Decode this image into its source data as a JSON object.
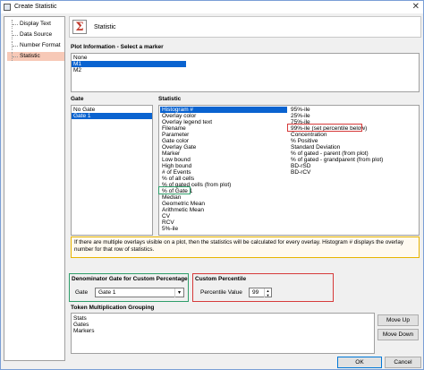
{
  "window": {
    "title": "Create Statistic",
    "close_glyph": "✕"
  },
  "nav": {
    "items": [
      {
        "label": "Display Text"
      },
      {
        "label": "Data Source"
      },
      {
        "label": "Number Format"
      },
      {
        "label": "Statistic",
        "selected": true
      }
    ]
  },
  "header": {
    "icon": "Σ",
    "title": "Statistic"
  },
  "plot_info": {
    "label": "Plot Information - Select a marker",
    "items": [
      "None",
      "M1",
      "M2"
    ],
    "selected": "M1"
  },
  "gate": {
    "label": "Gate",
    "items": [
      "No Gate",
      "Gate 1"
    ],
    "selected": "Gate 1"
  },
  "statistic": {
    "label": "Statistic",
    "col1": [
      "Histogram #",
      "Overlay color",
      "Overlay legend text",
      "Filename",
      "Parameter",
      "Gate color",
      "Overlay Gate",
      "Marker",
      "Low bound",
      "High bound",
      "# of Events",
      "% of all cells",
      "% of gated cells (from plot)",
      "% of Gate 1",
      "Median",
      "Geometric Mean",
      "Arithmetic Mean",
      "CV",
      "RCV",
      "5%-ile"
    ],
    "col2": [
      "95%-ile",
      "25%-ile",
      "75%-ile",
      "99%-ile (set percentile below)",
      "Concentration",
      "% Positive",
      "Standard Deviation",
      "% of gated - parent (from plot)",
      "% of gated - grandparent (from plot)",
      "BD-rSD",
      "BD-rCV"
    ],
    "selected": "Histogram #"
  },
  "info_text": "If there are multiple overlays visible on a plot, then the statistics will be calculated for every overlay. Histogram # displays the overlay number for that row of statistics.",
  "denominator": {
    "title": "Denominator Gate for Custom Percentage",
    "field_label": "Gate",
    "value": "Gate 1",
    "arrow": "▾"
  },
  "custom_percentile": {
    "title": "Custom Percentile",
    "field_label": "Percentile Value",
    "value": "99",
    "up": "▲",
    "down": "▼"
  },
  "token": {
    "label": "Token Multiplication Grouping",
    "items": [
      "Stats",
      "Gates",
      "Markers"
    ],
    "move_up": "Move Up",
    "move_down": "Move Down"
  },
  "footer": {
    "ok": "OK",
    "cancel": "Cancel"
  },
  "colors": {
    "highlight_red": "#d63a3a",
    "highlight_green": "#2e9e6a",
    "info_border": "#e8b400",
    "nav_selected": "#f7c9b7",
    "list_selected": "#0a63d0"
  }
}
